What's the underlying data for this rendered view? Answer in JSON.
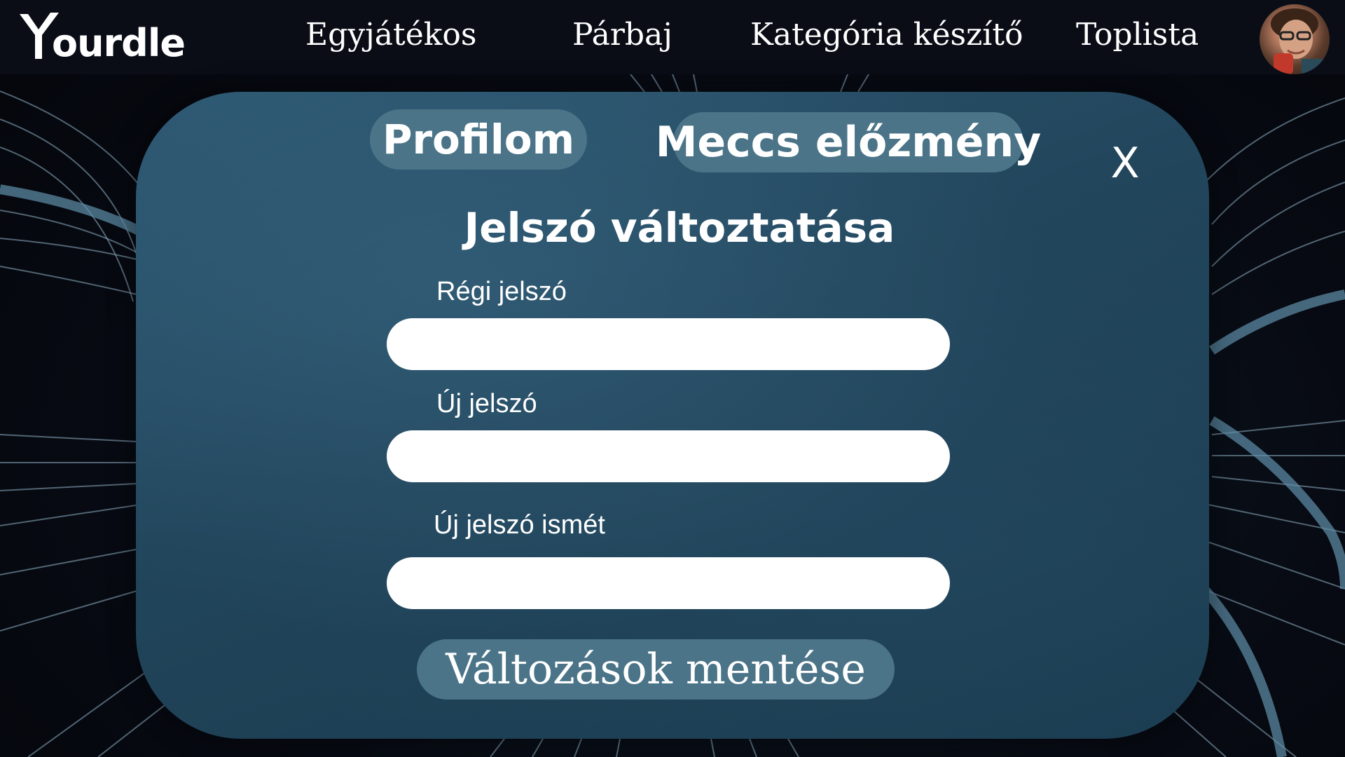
{
  "app": {
    "logo_text": "ourdle"
  },
  "nav": {
    "items": [
      {
        "label": "Egyjátékos"
      },
      {
        "label": "Párbaj"
      },
      {
        "label": "Kategória készítő"
      },
      {
        "label": "Toplista"
      }
    ]
  },
  "modal": {
    "tabs": [
      {
        "label": "Profilom"
      },
      {
        "label": "Meccs előzmény"
      }
    ],
    "close_label": "X",
    "title": "Jelszó változtatása",
    "fields": [
      {
        "label": "Régi jelszó",
        "value": ""
      },
      {
        "label": "Új jelszó",
        "value": ""
      },
      {
        "label": "Új jelszó ismét",
        "value": ""
      }
    ],
    "save_label": "Változások mentése"
  },
  "colors": {
    "topbar": "#0a0d16",
    "modal": "#21455b",
    "pill": "#4b7488",
    "text": "#ffffff"
  },
  "icons": {
    "logo": "y-logo-icon",
    "avatar": "user-avatar-icon"
  }
}
